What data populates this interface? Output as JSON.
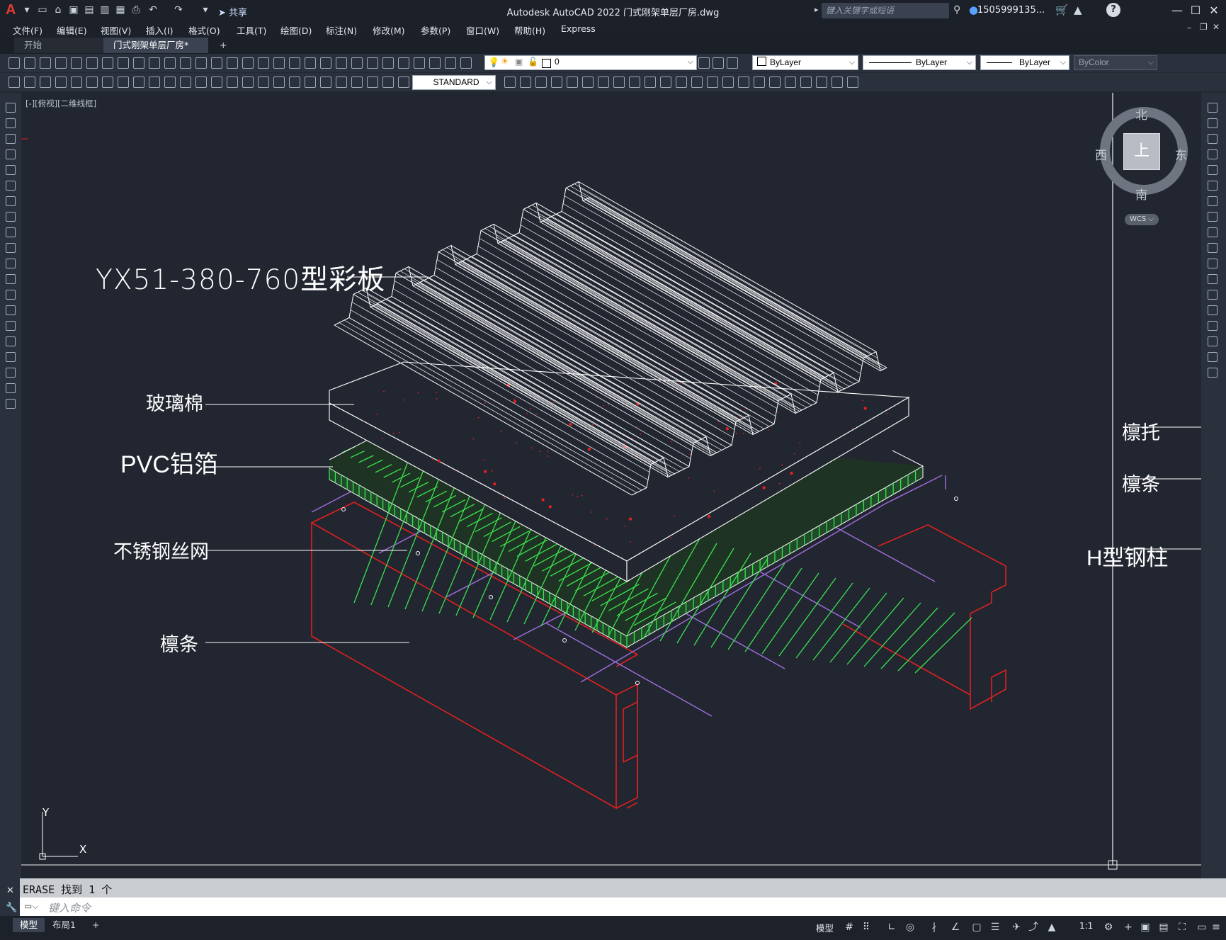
{
  "window": {
    "title": "Autodesk AutoCAD 2022    门式刚架单层厂房.dwg",
    "app_logo": "A",
    "share_label": "共享",
    "search_placeholder": "键入关键字或短语",
    "user": "1505999135...",
    "help": "?"
  },
  "menu": [
    "文件(F)",
    "编辑(E)",
    "视图(V)",
    "插入(I)",
    "格式(O)",
    "工具(T)",
    "绘图(D)",
    "标注(N)",
    "修改(M)",
    "参数(P)",
    "窗口(W)",
    "帮助(H)",
    "Express"
  ],
  "tabs": {
    "start": "开始",
    "active": "门式刚架单层厂房*",
    "close": "×",
    "add": "+"
  },
  "layer": {
    "current": "0"
  },
  "properties": {
    "color": "ByLayer",
    "linetype": "ByLayer",
    "lineweight": "ByLayer",
    "plotstyle": "ByColor"
  },
  "textstyle": "STANDARD",
  "viewport_label": "[-][俯视][二维线框]",
  "viewcube": {
    "north": "北",
    "south": "南",
    "east": "东",
    "west": "西",
    "face": "上",
    "wcs": "WCS"
  },
  "ucs": {
    "x": "X",
    "y": "Y"
  },
  "labels_left": {
    "panel": "YX51-380-760型彩板",
    "glasswool": "玻璃棉",
    "pvc": "PVC铝箔",
    "mesh": "不锈钢丝网",
    "purlin": "檩条"
  },
  "labels_right": {
    "purlin_bracket": "檩托",
    "purlin": "檩条",
    "column": "H型钢柱"
  },
  "command": {
    "history": "ERASE 找到 1 个",
    "placeholder": "键入命令"
  },
  "status": {
    "model": "模型",
    "layout1": "布局1",
    "add": "+",
    "model_btn": "模型",
    "scale": "1:1"
  },
  "colors": {
    "accent_red": "#e43a32",
    "drawing_bg": "#212630",
    "hatch_green": "#39e34d",
    "purlin_red": "#e02020",
    "mesh_purple": "#9b6bd6"
  }
}
